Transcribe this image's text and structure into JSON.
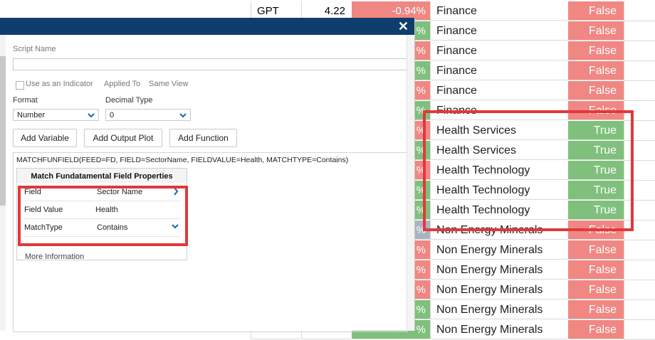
{
  "grid": {
    "rows": [
      {
        "symbol": "GPT",
        "price": "4.22",
        "change": "-0.94%",
        "change_tone": "neg",
        "sector": "Finance",
        "match": "False"
      },
      {
        "symbol": "",
        "price": "",
        "change": "%",
        "change_tone": "pos",
        "sector": "Finance",
        "match": "False"
      },
      {
        "symbol": "",
        "price": "",
        "change": "%",
        "change_tone": "neg",
        "sector": "Finance",
        "match": "False"
      },
      {
        "symbol": "",
        "price": "",
        "change": "%",
        "change_tone": "pos",
        "sector": "Finance",
        "match": "False"
      },
      {
        "symbol": "",
        "price": "",
        "change": "%",
        "change_tone": "neg",
        "sector": "Finance",
        "match": "False"
      },
      {
        "symbol": "",
        "price": "",
        "change": "%",
        "change_tone": "pos",
        "sector": "Finance",
        "match": "False"
      },
      {
        "symbol": "",
        "price": "",
        "change": "%",
        "change_tone": "neg",
        "sector": "Health Services",
        "match": "True"
      },
      {
        "symbol": "",
        "price": "",
        "change": "%",
        "change_tone": "pos",
        "sector": "Health Services",
        "match": "True"
      },
      {
        "symbol": "",
        "price": "",
        "change": "%",
        "change_tone": "neg",
        "sector": "Health Technology",
        "match": "True"
      },
      {
        "symbol": "",
        "price": "",
        "change": "%",
        "change_tone": "pos",
        "sector": "Health Technology",
        "match": "True"
      },
      {
        "symbol": "",
        "price": "",
        "change": "%",
        "change_tone": "pos",
        "sector": "Health Technology",
        "match": "True"
      },
      {
        "symbol": "",
        "price": "",
        "change": "%",
        "change_tone": "neu",
        "sector": "Non Energy Minerals",
        "match": "False"
      },
      {
        "symbol": "",
        "price": "",
        "change": "%",
        "change_tone": "neg",
        "sector": "Non Energy Minerals",
        "match": "False"
      },
      {
        "symbol": "",
        "price": "",
        "change": "%",
        "change_tone": "neg",
        "sector": "Non Energy Minerals",
        "match": "False"
      },
      {
        "symbol": "",
        "price": "",
        "change": "%",
        "change_tone": "neg",
        "sector": "Non Energy Minerals",
        "match": "False"
      },
      {
        "symbol": "",
        "price": "",
        "change": "%",
        "change_tone": "pos",
        "sector": "Non Energy Minerals",
        "match": "False"
      },
      {
        "symbol": "",
        "price": "",
        "change": "%",
        "change_tone": "pos",
        "sector": "Non Energy Minerals",
        "match": "False"
      }
    ]
  },
  "dialog": {
    "close_icon": "close-icon",
    "script_name_label": "Script Name",
    "script_name_value": "",
    "use_as_indicator_label": "Use as an Indicator",
    "applied_to_label": "Applied To",
    "applied_to_value": "Same View",
    "format_label": "Format",
    "format_value": "Number",
    "decimal_type_label": "Decimal Type",
    "decimal_type_value": "0",
    "add_variable_label": "Add Variable",
    "add_output_plot_label": "Add Output Plot",
    "add_function_label": "Add Function",
    "formula": "MATCHFUNFIELD(FEED=FD, FIELD=SectorName, FIELDVALUE=Health, MATCHTYPE=Contains)",
    "properties": {
      "title": "Match Fundatamental Field Properties",
      "rows": [
        {
          "name": "Field",
          "value": "Sector Name",
          "control": "arrow-right-icon"
        },
        {
          "name": "Field Value",
          "value": "Health",
          "control": ""
        },
        {
          "name": "MatchType",
          "value": "Contains",
          "control": "chevron-down-icon"
        }
      ],
      "more_info_label": "More Information"
    }
  },
  "colors": {
    "title_bar": "#0f3d6d",
    "negative": "#f08783",
    "positive": "#7fc07c",
    "neutral": "#a9b4c0",
    "highlight": "#e2383a",
    "accent_icon": "#1f6fb2"
  }
}
